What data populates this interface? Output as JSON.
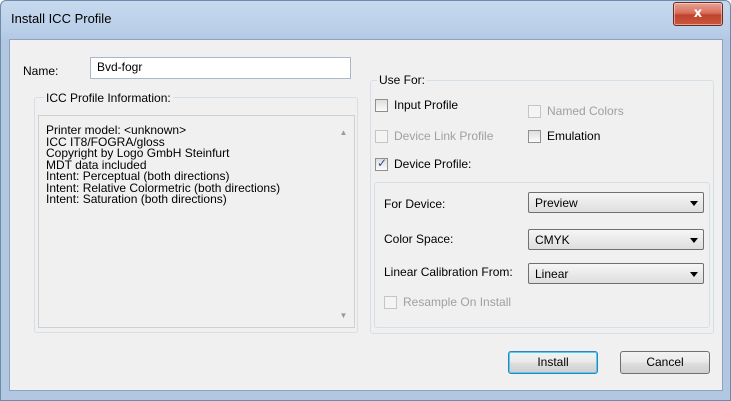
{
  "window": {
    "title": "Install ICC Profile",
    "close_label": "x"
  },
  "name_field": {
    "label": "Name:",
    "value": "Bvd-fogr"
  },
  "profile_info": {
    "caption": "ICC Profile Information:",
    "lines": [
      "Printer model: <unknown>",
      "ICC IT8/FOGRA/gloss",
      "Copyright by Logo GmbH Steinfurt",
      "MDT data included",
      "Intent: Perceptual (both directions)",
      "Intent: Relative Colormetric (both directions)",
      "Intent: Saturation (both directions)"
    ]
  },
  "use_for": {
    "caption": "Use For:",
    "input_profile": {
      "label": "Input Profile",
      "checked": false,
      "enabled": true
    },
    "named_colors": {
      "label": "Named Colors",
      "checked": false,
      "enabled": false
    },
    "device_link_profile": {
      "label": "Device Link Profile",
      "checked": false,
      "enabled": false
    },
    "emulation": {
      "label": "Emulation",
      "checked": false,
      "enabled": true
    },
    "device_profile": {
      "label": "Device Profile:",
      "checked": true,
      "enabled": true
    }
  },
  "device": {
    "for_device": {
      "label": "For Device:",
      "value": "Preview"
    },
    "color_space": {
      "label": "Color Space:",
      "value": "CMYK"
    },
    "linear_calibration": {
      "label": "Linear Calibration From:",
      "value": "Linear"
    },
    "resample": {
      "label": "Resample On Install",
      "checked": false,
      "enabled": false
    }
  },
  "buttons": {
    "install": "Install",
    "cancel": "Cancel"
  },
  "colors": {
    "title_bar": "#b9cfe8",
    "close_button": "#c9573f",
    "dialog_bg": "#f0f0f0"
  }
}
